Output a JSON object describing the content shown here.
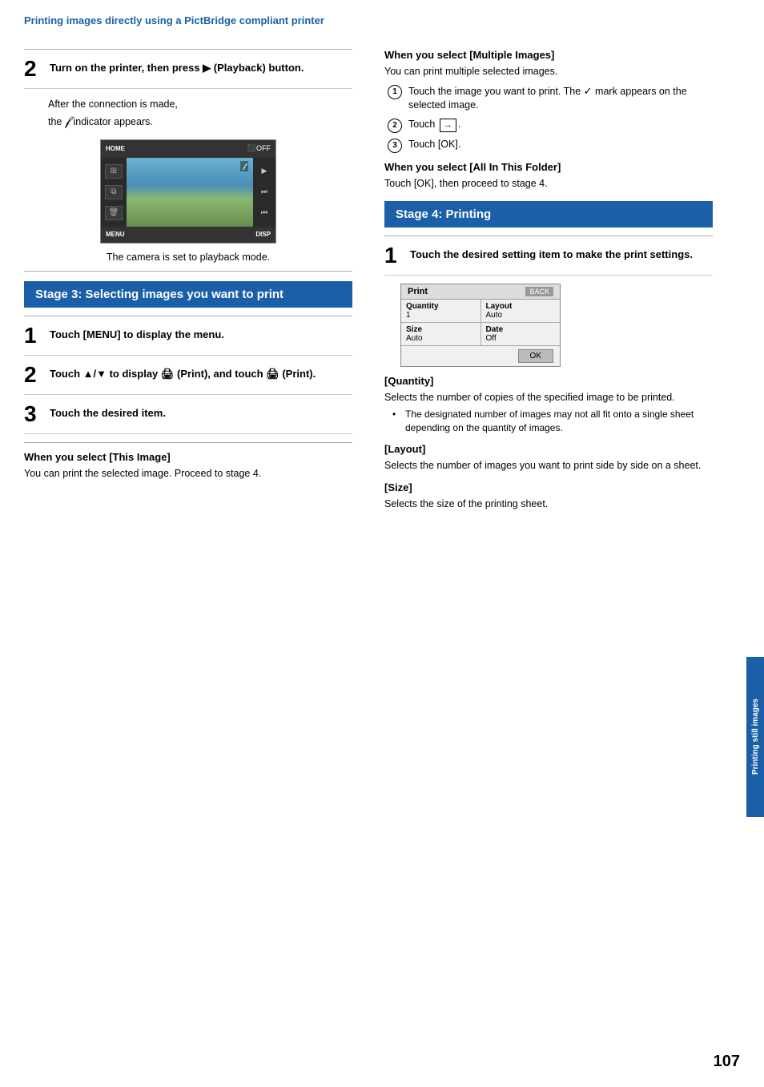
{
  "header": {
    "title": "Printing images directly using a PictBridge compliant printer"
  },
  "left": {
    "step2_num": "2",
    "step2_text": "Turn on the printer, then press  (Playback) button.",
    "indent1": "After the connection is made,",
    "indent2": "the",
    "indent2b": "indicator appears.",
    "camera_caption": "The camera is set to playback mode.",
    "stage3_label": "Stage 3: Selecting images you want to print",
    "step3_1_num": "1",
    "step3_1_text": "Touch [MENU] to display the menu.",
    "step3_2_num": "2",
    "step3_2_text": "Touch ▲/▼ to display  (Print), and touch  (Print).",
    "step3_3_num": "3",
    "step3_3_text": "Touch the desired item.",
    "subsec1": "When you select [This Image]",
    "subsec1_text": "You can print the selected image. Proceed to stage 4."
  },
  "right": {
    "subsec2": "When you select [Multiple Images]",
    "subsec2_text": "You can print multiple selected images.",
    "item1_text": "Touch the image you want to print. The",
    "item1_mark": "✓",
    "item1_text2": "mark appears on the selected image.",
    "item2_text": "Touch",
    "item2_arrow": "→",
    "item3_text": "Touch [OK].",
    "subsec3": "When you select [All In This Folder]",
    "subsec3_text": "Touch [OK], then proceed to stage 4.",
    "stage4_label": "Stage 4: Printing",
    "step4_1_num": "1",
    "step4_1_text": "Touch the desired setting item to make the print settings.",
    "ps_title": "Print",
    "ps_back": "BACK",
    "ps_qty_label": "Quantity",
    "ps_qty_val": "1",
    "ps_layout_label": "Layout",
    "ps_layout_val": "Auto",
    "ps_size_label": "Size",
    "ps_size_val": "Auto",
    "ps_date_label": "Date",
    "ps_date_val": "Off",
    "ps_ok": "OK",
    "qty_header": "[Quantity]",
    "qty_text": "Selects the number of copies of the specified image to be printed.",
    "qty_bullet": "The designated number of images may not all fit onto a single sheet depending on the quantity of images.",
    "layout_header": "[Layout]",
    "layout_text": "Selects the number of images you want to print side by side on a sheet.",
    "size_header": "[Size]",
    "size_text": "Selects the size of the printing sheet."
  },
  "side_tab": "Printing still images",
  "page_number": "107"
}
